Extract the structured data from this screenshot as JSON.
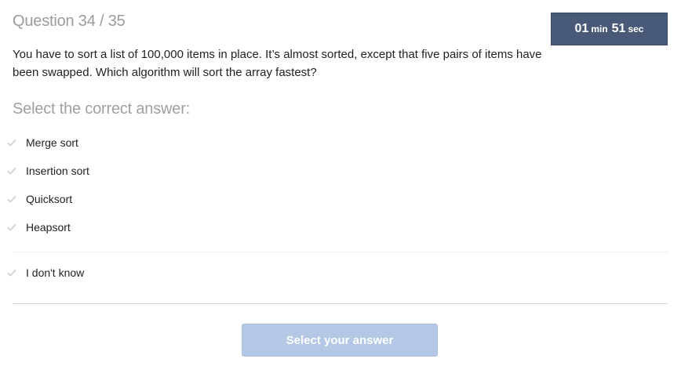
{
  "header": {
    "question_counter": "Question 34 / 35"
  },
  "timer": {
    "minutes": "01",
    "minutes_unit": "min",
    "seconds": "51",
    "seconds_unit": "sec"
  },
  "question": {
    "text": "You have to sort a list of 100,000 items in place. It’s almost sorted, except that five pairs of items have been swapped. Which algorithm will sort the array fastest?"
  },
  "answers": {
    "prompt": "Select the correct answer:",
    "options": [
      {
        "label": "Merge sort"
      },
      {
        "label": "Insertion sort"
      },
      {
        "label": "Quicksort"
      },
      {
        "label": "Heapsort"
      }
    ],
    "dont_know": "I don't know"
  },
  "submit": {
    "label": "Select your answer"
  },
  "colors": {
    "timer_bg": "#485a78",
    "submit_disabled_bg": "#b4c8e6",
    "checkmark": "#d0d0d0"
  },
  "icons": {
    "option_marker": "checkmark-icon"
  }
}
